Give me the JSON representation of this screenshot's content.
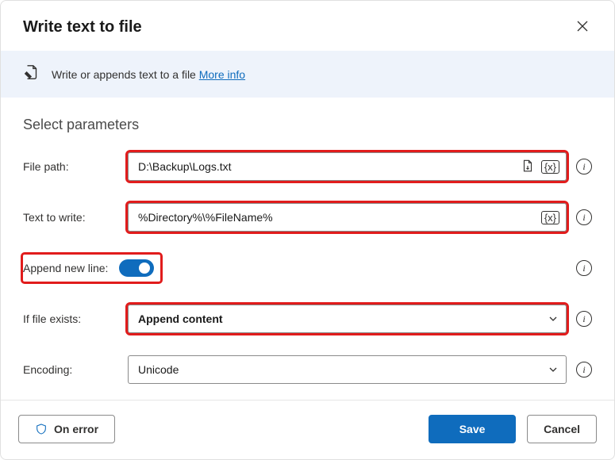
{
  "header": {
    "title": "Write text to file"
  },
  "banner": {
    "text": "Write or appends text to a file",
    "link_label": "More info"
  },
  "section_title": "Select parameters",
  "fields": {
    "file_path": {
      "label": "File path:",
      "value": "D:\\Backup\\Logs.txt"
    },
    "text_to_write": {
      "label": "Text to write:",
      "value": "%Directory%\\%FileName%"
    },
    "append_new_line": {
      "label": "Append new line:",
      "value": true
    },
    "if_file_exists": {
      "label": "If file exists:",
      "value": "Append content"
    },
    "encoding": {
      "label": "Encoding:",
      "value": "Unicode"
    }
  },
  "var_token": "{x}",
  "footer": {
    "on_error": "On error",
    "save": "Save",
    "cancel": "Cancel"
  }
}
